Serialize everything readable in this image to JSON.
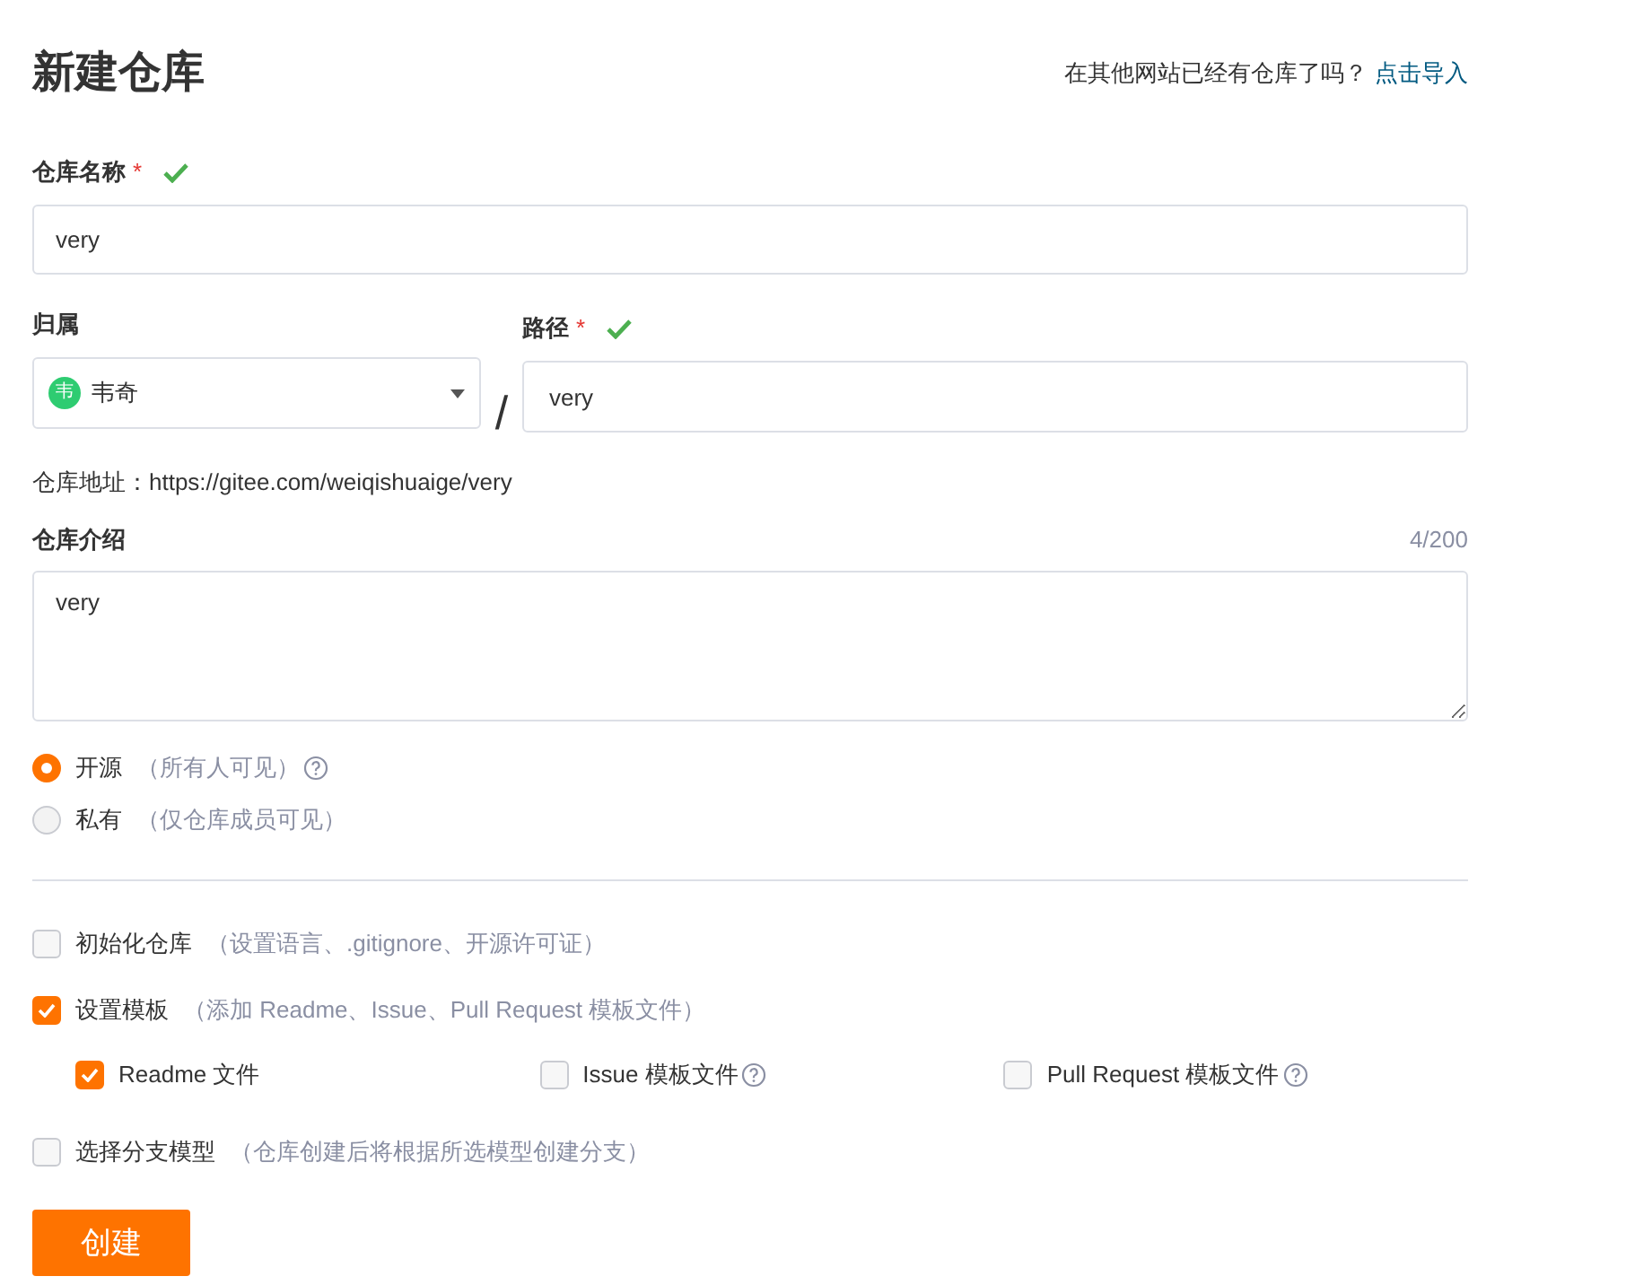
{
  "title": "新建仓库",
  "import_prompt": "在其他网站已经有仓库了吗？",
  "import_link": "点击导入",
  "name_field": {
    "label": "仓库名称",
    "required_mark": "*",
    "valid": true,
    "value": "very"
  },
  "owner": {
    "label": "归属",
    "avatar_text": "韦",
    "value": "韦奇"
  },
  "separator": "/",
  "path_field": {
    "label": "路径",
    "required_mark": "*",
    "valid": true,
    "value": "very"
  },
  "address": {
    "label": "仓库地址：",
    "value": "https://gitee.com/weiqishuaige/very"
  },
  "description": {
    "label": "仓库介绍",
    "counter": "4/200",
    "value": "very"
  },
  "visibility": [
    {
      "label": "开源",
      "hint": "（所有人可见）",
      "selected": true,
      "help": true
    },
    {
      "label": "私有",
      "hint": "（仅仓库成员可见）",
      "selected": false,
      "help": false
    }
  ],
  "options": [
    {
      "label": "初始化仓库",
      "hint": "（设置语言、.gitignore、开源许可证）",
      "checked": false
    },
    {
      "label": "设置模板",
      "hint": "（添加 Readme、Issue、Pull Request 模板文件）",
      "checked": true,
      "children": [
        {
          "label": "Readme 文件",
          "checked": true,
          "help": false
        },
        {
          "label": "Issue 模板文件",
          "checked": false,
          "help": true
        },
        {
          "label": "Pull Request 模板文件",
          "checked": false,
          "help": true
        }
      ]
    },
    {
      "label": "选择分支模型",
      "hint": "（仓库创建后将根据所选模型创建分支）",
      "checked": false
    }
  ],
  "submit": "创建"
}
